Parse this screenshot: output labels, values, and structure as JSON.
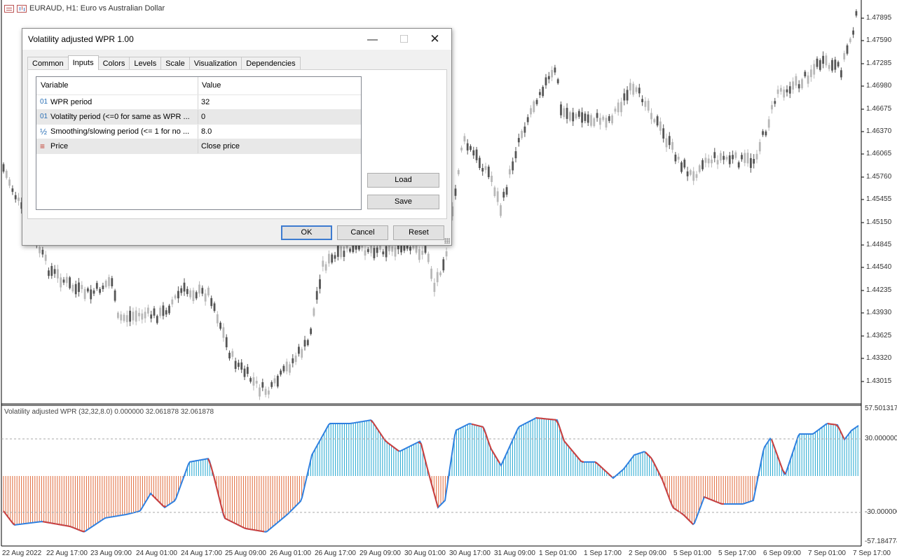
{
  "chart": {
    "header": "EURAUD, H1:  Euro vs Australian Dollar",
    "price_labels": [
      "1.47895",
      "1.47590",
      "1.47285",
      "1.46980",
      "1.46675",
      "1.46370",
      "1.46065",
      "1.45760",
      "1.45455",
      "1.45150",
      "1.44845",
      "1.44540",
      "1.44235",
      "1.43930",
      "1.43625",
      "1.43320",
      "1.43015"
    ],
    "time_labels": [
      "22 Aug 2022",
      "22 Aug 17:00",
      "23 Aug 09:00",
      "24 Aug 01:00",
      "24 Aug 17:00",
      "25 Aug 09:00",
      "26 Aug 01:00",
      "26 Aug 17:00",
      "29 Aug 09:00",
      "30 Aug 01:00",
      "30 Aug 17:00",
      "31 Aug 09:00",
      "1 Sep 01:00",
      "1 Sep 17:00",
      "2 Sep 09:00",
      "5 Sep 01:00",
      "5 Sep 17:00",
      "6 Sep 09:00",
      "7 Sep 01:00",
      "7 Sep 17:00"
    ]
  },
  "indicator": {
    "label": "Volatility adjusted WPR (32,32,8.0) 0.000000 32.061878 32.061878",
    "levels": [
      "57.501317",
      "30.000000",
      "-30.000000",
      "-57.184774"
    ],
    "colors": {
      "up": "#1fa6cf",
      "down": "#e06a3a",
      "line_up": "#2f80e0",
      "line_down": "#d2403a"
    }
  },
  "dialog": {
    "title": "Volatility adjusted WPR 1.00",
    "tabs": [
      "Common",
      "Inputs",
      "Colors",
      "Levels",
      "Scale",
      "Visualization",
      "Dependencies"
    ],
    "active_tab": "Inputs",
    "columns": {
      "variable": "Variable",
      "value": "Value"
    },
    "rows": [
      {
        "icon": "01",
        "variable": "WPR period",
        "value": "32"
      },
      {
        "icon": "01",
        "variable": "Volatilty period (<=0 for same as WPR ...",
        "value": "0"
      },
      {
        "icon": "½",
        "variable": "Smoothing/slowing period (<= 1 for no ...",
        "value": "8.0"
      },
      {
        "icon": "≡",
        "variable": "Price",
        "value": "Close price"
      }
    ],
    "buttons": {
      "load": "Load",
      "save": "Save",
      "ok": "OK",
      "cancel": "Cancel",
      "reset": "Reset"
    }
  }
}
